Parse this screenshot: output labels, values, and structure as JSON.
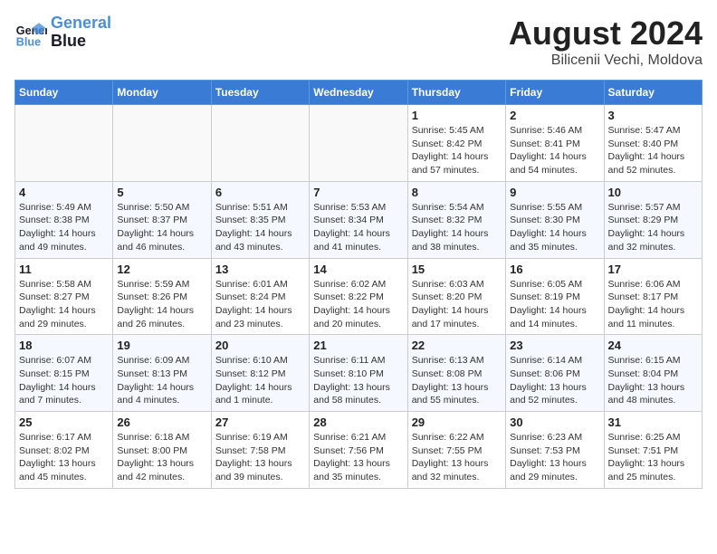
{
  "header": {
    "logo_line1": "General",
    "logo_line2": "Blue",
    "month_title": "August 2024",
    "location": "Bilicenii Vechi, Moldova"
  },
  "weekdays": [
    "Sunday",
    "Monday",
    "Tuesday",
    "Wednesday",
    "Thursday",
    "Friday",
    "Saturday"
  ],
  "weeks": [
    [
      {
        "day": "",
        "info": ""
      },
      {
        "day": "",
        "info": ""
      },
      {
        "day": "",
        "info": ""
      },
      {
        "day": "",
        "info": ""
      },
      {
        "day": "1",
        "info": "Sunrise: 5:45 AM\nSunset: 8:42 PM\nDaylight: 14 hours\nand 57 minutes."
      },
      {
        "day": "2",
        "info": "Sunrise: 5:46 AM\nSunset: 8:41 PM\nDaylight: 14 hours\nand 54 minutes."
      },
      {
        "day": "3",
        "info": "Sunrise: 5:47 AM\nSunset: 8:40 PM\nDaylight: 14 hours\nand 52 minutes."
      }
    ],
    [
      {
        "day": "4",
        "info": "Sunrise: 5:49 AM\nSunset: 8:38 PM\nDaylight: 14 hours\nand 49 minutes."
      },
      {
        "day": "5",
        "info": "Sunrise: 5:50 AM\nSunset: 8:37 PM\nDaylight: 14 hours\nand 46 minutes."
      },
      {
        "day": "6",
        "info": "Sunrise: 5:51 AM\nSunset: 8:35 PM\nDaylight: 14 hours\nand 43 minutes."
      },
      {
        "day": "7",
        "info": "Sunrise: 5:53 AM\nSunset: 8:34 PM\nDaylight: 14 hours\nand 41 minutes."
      },
      {
        "day": "8",
        "info": "Sunrise: 5:54 AM\nSunset: 8:32 PM\nDaylight: 14 hours\nand 38 minutes."
      },
      {
        "day": "9",
        "info": "Sunrise: 5:55 AM\nSunset: 8:30 PM\nDaylight: 14 hours\nand 35 minutes."
      },
      {
        "day": "10",
        "info": "Sunrise: 5:57 AM\nSunset: 8:29 PM\nDaylight: 14 hours\nand 32 minutes."
      }
    ],
    [
      {
        "day": "11",
        "info": "Sunrise: 5:58 AM\nSunset: 8:27 PM\nDaylight: 14 hours\nand 29 minutes."
      },
      {
        "day": "12",
        "info": "Sunrise: 5:59 AM\nSunset: 8:26 PM\nDaylight: 14 hours\nand 26 minutes."
      },
      {
        "day": "13",
        "info": "Sunrise: 6:01 AM\nSunset: 8:24 PM\nDaylight: 14 hours\nand 23 minutes."
      },
      {
        "day": "14",
        "info": "Sunrise: 6:02 AM\nSunset: 8:22 PM\nDaylight: 14 hours\nand 20 minutes."
      },
      {
        "day": "15",
        "info": "Sunrise: 6:03 AM\nSunset: 8:20 PM\nDaylight: 14 hours\nand 17 minutes."
      },
      {
        "day": "16",
        "info": "Sunrise: 6:05 AM\nSunset: 8:19 PM\nDaylight: 14 hours\nand 14 minutes."
      },
      {
        "day": "17",
        "info": "Sunrise: 6:06 AM\nSunset: 8:17 PM\nDaylight: 14 hours\nand 11 minutes."
      }
    ],
    [
      {
        "day": "18",
        "info": "Sunrise: 6:07 AM\nSunset: 8:15 PM\nDaylight: 14 hours\nand 7 minutes."
      },
      {
        "day": "19",
        "info": "Sunrise: 6:09 AM\nSunset: 8:13 PM\nDaylight: 14 hours\nand 4 minutes."
      },
      {
        "day": "20",
        "info": "Sunrise: 6:10 AM\nSunset: 8:12 PM\nDaylight: 14 hours\nand 1 minute."
      },
      {
        "day": "21",
        "info": "Sunrise: 6:11 AM\nSunset: 8:10 PM\nDaylight: 13 hours\nand 58 minutes."
      },
      {
        "day": "22",
        "info": "Sunrise: 6:13 AM\nSunset: 8:08 PM\nDaylight: 13 hours\nand 55 minutes."
      },
      {
        "day": "23",
        "info": "Sunrise: 6:14 AM\nSunset: 8:06 PM\nDaylight: 13 hours\nand 52 minutes."
      },
      {
        "day": "24",
        "info": "Sunrise: 6:15 AM\nSunset: 8:04 PM\nDaylight: 13 hours\nand 48 minutes."
      }
    ],
    [
      {
        "day": "25",
        "info": "Sunrise: 6:17 AM\nSunset: 8:02 PM\nDaylight: 13 hours\nand 45 minutes."
      },
      {
        "day": "26",
        "info": "Sunrise: 6:18 AM\nSunset: 8:00 PM\nDaylight: 13 hours\nand 42 minutes."
      },
      {
        "day": "27",
        "info": "Sunrise: 6:19 AM\nSunset: 7:58 PM\nDaylight: 13 hours\nand 39 minutes."
      },
      {
        "day": "28",
        "info": "Sunrise: 6:21 AM\nSunset: 7:56 PM\nDaylight: 13 hours\nand 35 minutes."
      },
      {
        "day": "29",
        "info": "Sunrise: 6:22 AM\nSunset: 7:55 PM\nDaylight: 13 hours\nand 32 minutes."
      },
      {
        "day": "30",
        "info": "Sunrise: 6:23 AM\nSunset: 7:53 PM\nDaylight: 13 hours\nand 29 minutes."
      },
      {
        "day": "31",
        "info": "Sunrise: 6:25 AM\nSunset: 7:51 PM\nDaylight: 13 hours\nand 25 minutes."
      }
    ]
  ]
}
